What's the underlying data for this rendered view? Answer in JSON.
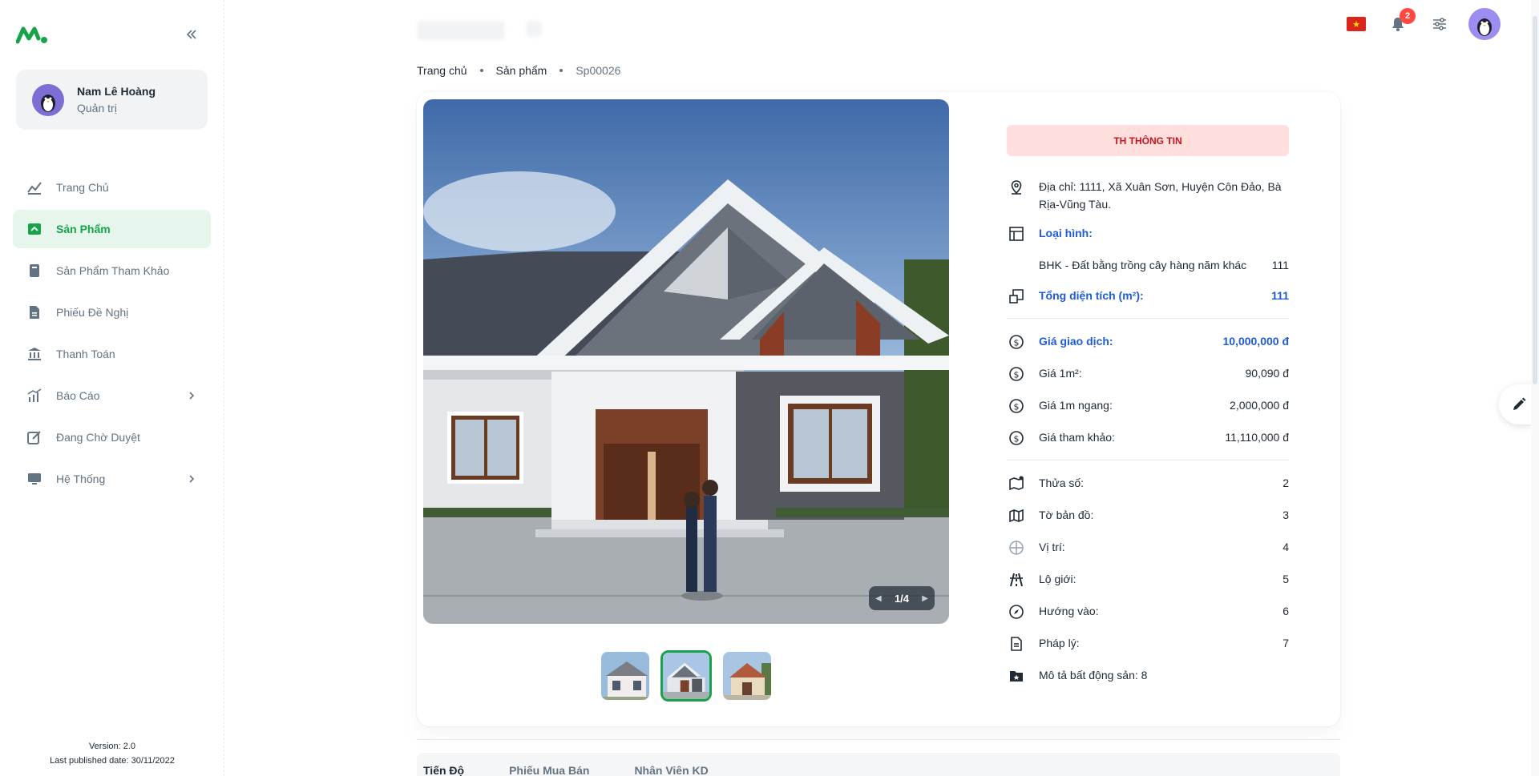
{
  "sidebar": {
    "user": {
      "name": "Nam Lê Hoàng",
      "role": "Quản trị"
    },
    "items": [
      {
        "label": "Trang Chủ",
        "icon": "chart-home-icon"
      },
      {
        "label": "Sản Phẩm",
        "icon": "product-icon",
        "active": true
      },
      {
        "label": "Sản Phẩm Tham Khảo",
        "icon": "book-icon"
      },
      {
        "label": "Phiếu Đề Nghị",
        "icon": "document-icon"
      },
      {
        "label": "Thanh Toán",
        "icon": "bank-icon"
      },
      {
        "label": "Báo Cáo",
        "icon": "report-icon",
        "has_children": true
      },
      {
        "label": "Đang Chờ Duyệt",
        "icon": "edit-square-icon"
      },
      {
        "label": "Hệ Thống",
        "icon": "monitor-icon",
        "has_children": true
      }
    ],
    "version": "Version: 2.0",
    "published": "Last published date: 30/11/2022"
  },
  "header": {
    "notification_count": "2",
    "flag_icon": "vietnam-flag-icon"
  },
  "breadcrumb": [
    "Trang chủ",
    "Sản phẩm",
    "Sp00026"
  ],
  "gallery": {
    "pager": "1/4",
    "active_thumb": 2
  },
  "info": {
    "header": "TH THÔNG TIN",
    "address": "Địa chỉ: 1111, Xã Xuân Sơn, Huyện Côn Đảo, Bà Rịa-Vũng Tàu.",
    "type_label": "Loại hình:",
    "type_value_label": "BHK - Đất bằng trồng cây hàng năm khác",
    "type_value": "111",
    "area_label": "Tổng diện tích (m²):",
    "area_value": "111",
    "price_label": "Giá giao dịch:",
    "price_value": "10,000,000 đ",
    "price_m2_label": "Giá 1m²:",
    "price_m2_value": "90,090 đ",
    "price_width_label": "Giá 1m ngang:",
    "price_width_value": "2,000,000 đ",
    "price_ref_label": "Giá tham khảo:",
    "price_ref_value": "11,110,000 đ",
    "parcel_label": "Thửa số:",
    "parcel_value": "2",
    "map_label": "Tờ bản đồ:",
    "map_value": "3",
    "position_label": "Vị trí:",
    "position_value": "4",
    "road_label": "Lộ giới:",
    "road_value": "5",
    "direction_label": "Hướng vào:",
    "direction_value": "6",
    "legal_label": "Pháp lý:",
    "legal_value": "7",
    "description": "Mô tả bất động sản: 8"
  },
  "tabs": [
    "Tiến Độ",
    "Phiếu Mua Bán",
    "Nhân Viên KD"
  ],
  "colors": {
    "accent": "#17a34a",
    "blue": "#1e5bd6",
    "danger": "#c4161c"
  }
}
